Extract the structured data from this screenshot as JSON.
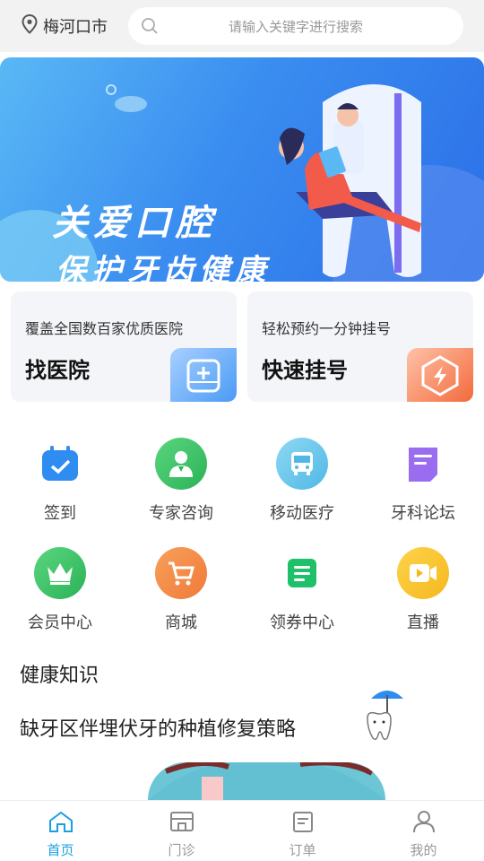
{
  "header": {
    "city": "梅河口市",
    "search_placeholder": "请输入关键字进行搜索"
  },
  "banner": {
    "line1": "关爱口腔",
    "line2": "保护牙齿健康"
  },
  "cards": [
    {
      "subtitle": "覆盖全国数百家优质医院",
      "title": "找医院",
      "icon": "hospital-icon",
      "color": "#4a9af5"
    },
    {
      "subtitle": "轻松预约一分钟挂号",
      "title": "快速挂号",
      "icon": "lightning-icon",
      "color": "#f36a3c"
    }
  ],
  "grid": [
    {
      "label": "签到",
      "icon": "calendar-check-icon",
      "color": "#2f8cf0"
    },
    {
      "label": "专家咨询",
      "icon": "doctor-icon",
      "color": "#3cc46a"
    },
    {
      "label": "移动医疗",
      "icon": "bus-icon",
      "color": "#4fb8e6"
    },
    {
      "label": "牙科论坛",
      "icon": "forum-icon",
      "color": "#9a6cf0"
    },
    {
      "label": "会员中心",
      "icon": "crown-icon",
      "color": "#3cc46a"
    },
    {
      "label": "商城",
      "icon": "cart-icon",
      "color": "#f07a3a"
    },
    {
      "label": "领券中心",
      "icon": "coupon-icon",
      "color": "#1fc06a"
    },
    {
      "label": "直播",
      "icon": "video-icon",
      "color": "#f5b81e"
    }
  ],
  "health": {
    "section_title": "健康知识",
    "article_title": "缺牙区伴埋伏牙的种植修复策略"
  },
  "tabs": [
    {
      "label": "首页",
      "icon": "home-icon",
      "active": true
    },
    {
      "label": "门诊",
      "icon": "clinic-icon",
      "active": false
    },
    {
      "label": "订单",
      "icon": "order-icon",
      "active": false
    },
    {
      "label": "我的",
      "icon": "user-icon",
      "active": false
    }
  ],
  "colors": {
    "accent": "#1a9fe0"
  }
}
